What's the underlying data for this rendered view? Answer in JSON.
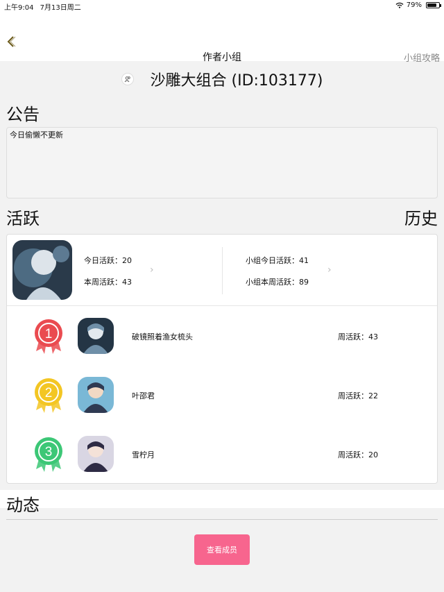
{
  "status_bar": {
    "time": "上午9:04",
    "date": "7月13日周二",
    "battery": "79%",
    "battery_level": 0.79
  },
  "nav": {
    "title": "作者小组",
    "right_link": "小组攻略"
  },
  "group": {
    "name": "沙雕大组合 (ID:103177)"
  },
  "notice": {
    "heading": "公告",
    "text": "今日偷懒不更新"
  },
  "activity": {
    "heading": "活跃",
    "history_link": "历史",
    "today_active": "今日活跃：20",
    "week_active": "本周活跃：43",
    "group_today_active": "小组今日活跃：41",
    "group_week_active": "小组本周活跃：89",
    "ranking": [
      {
        "rank": "1",
        "name": "破镜照着渔女梳头",
        "weekly": "周活跃：43",
        "medal_color": "#ea4b50"
      },
      {
        "rank": "2",
        "name": "叶邵君",
        "weekly": "周活跃：22",
        "medal_color": "#f3c623"
      },
      {
        "rank": "3",
        "name": "雪柠月",
        "weekly": "周活跃：20",
        "medal_color": "#3cc776"
      }
    ]
  },
  "feed": {
    "heading": "动态"
  },
  "members_button": "查看成员"
}
